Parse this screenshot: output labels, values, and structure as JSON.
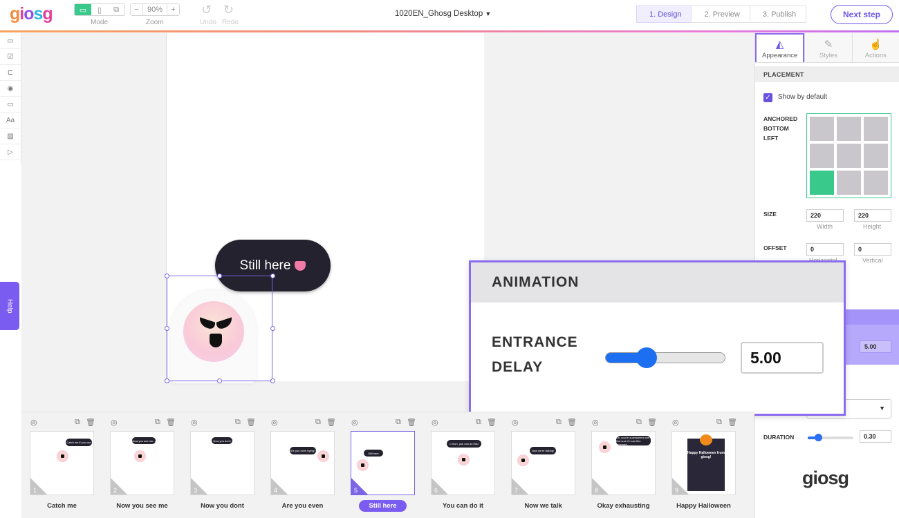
{
  "header": {
    "logo": "giosg",
    "mode_label": "Mode",
    "zoom_label": "Zoom",
    "zoom_value": "90%",
    "zoom_minus": "−",
    "zoom_plus": "+",
    "undo_label": "Undo",
    "redo_label": "Redo",
    "document_title": "1020EN_Ghosg Desktop",
    "steps": [
      "1. Design",
      "2. Preview",
      "3. Publish"
    ],
    "next_button": "Next step"
  },
  "help_label": "Help",
  "canvas": {
    "bubble_text": "Still here"
  },
  "panel": {
    "tabs": [
      {
        "label": "Appearance",
        "icon": "appearance-icon"
      },
      {
        "label": "Styles",
        "icon": "brush-icon"
      },
      {
        "label": "Actions",
        "icon": "pointer-icon"
      }
    ],
    "placement_header": "PLACEMENT",
    "show_by_default": "Show by default",
    "anchored_label": "ANCHORED\nBOTTOM\nLEFT",
    "anchor_selected": "bottom-left",
    "size_label": "SIZE",
    "width_value": "220",
    "height_value": "220",
    "width_caption": "Width",
    "height_caption": "Height",
    "offset_label": "OFFSET",
    "offset_h_value": "0",
    "offset_v_value": "0",
    "offset_h_caption": "Horizontal",
    "offset_v_caption": "Vertical",
    "entrance_delay_small": "5.00",
    "duration_label": "DURATION",
    "duration_value": "0.30",
    "duration_fraction": 0.2,
    "bottom_logo": "giosg"
  },
  "zoom_callout": {
    "header": "ANIMATION",
    "label_line1": "ENTRANCE",
    "label_line2": "DELAY",
    "value": "5.00",
    "slider_fraction": 0.36
  },
  "slides": [
    {
      "num": "1",
      "label": "Catch me",
      "bubble": "Catch me if you can"
    },
    {
      "num": "2",
      "label": "Now you see me",
      "bubble": "Now you see me..."
    },
    {
      "num": "3",
      "label": "Now you dont",
      "bubble": "Now you don't"
    },
    {
      "num": "4",
      "label": "Are you even",
      "bubble": "Are you even trying?"
    },
    {
      "num": "5",
      "label": "Still here",
      "bubble": "Still here",
      "active": true
    },
    {
      "num": "6",
      "label": "You can do it",
      "bubble": "C'mon, you can do this!"
    },
    {
      "num": "7",
      "label": "Now we talk",
      "bubble": "Now we're talking!"
    },
    {
      "num": "8",
      "label": "Okay exhausting",
      "bubble": "Ok, you're a persistent one. Not sure if I can flee anymore."
    },
    {
      "num": "9",
      "label": "Happy Halloween",
      "bubble": "Happy Halloween from giosg!"
    }
  ],
  "colors": {
    "accent": "#7b5cf0",
    "green": "#39c98b",
    "dark_bubble": "#24222e",
    "slider_blue": "#1d6ff2"
  }
}
